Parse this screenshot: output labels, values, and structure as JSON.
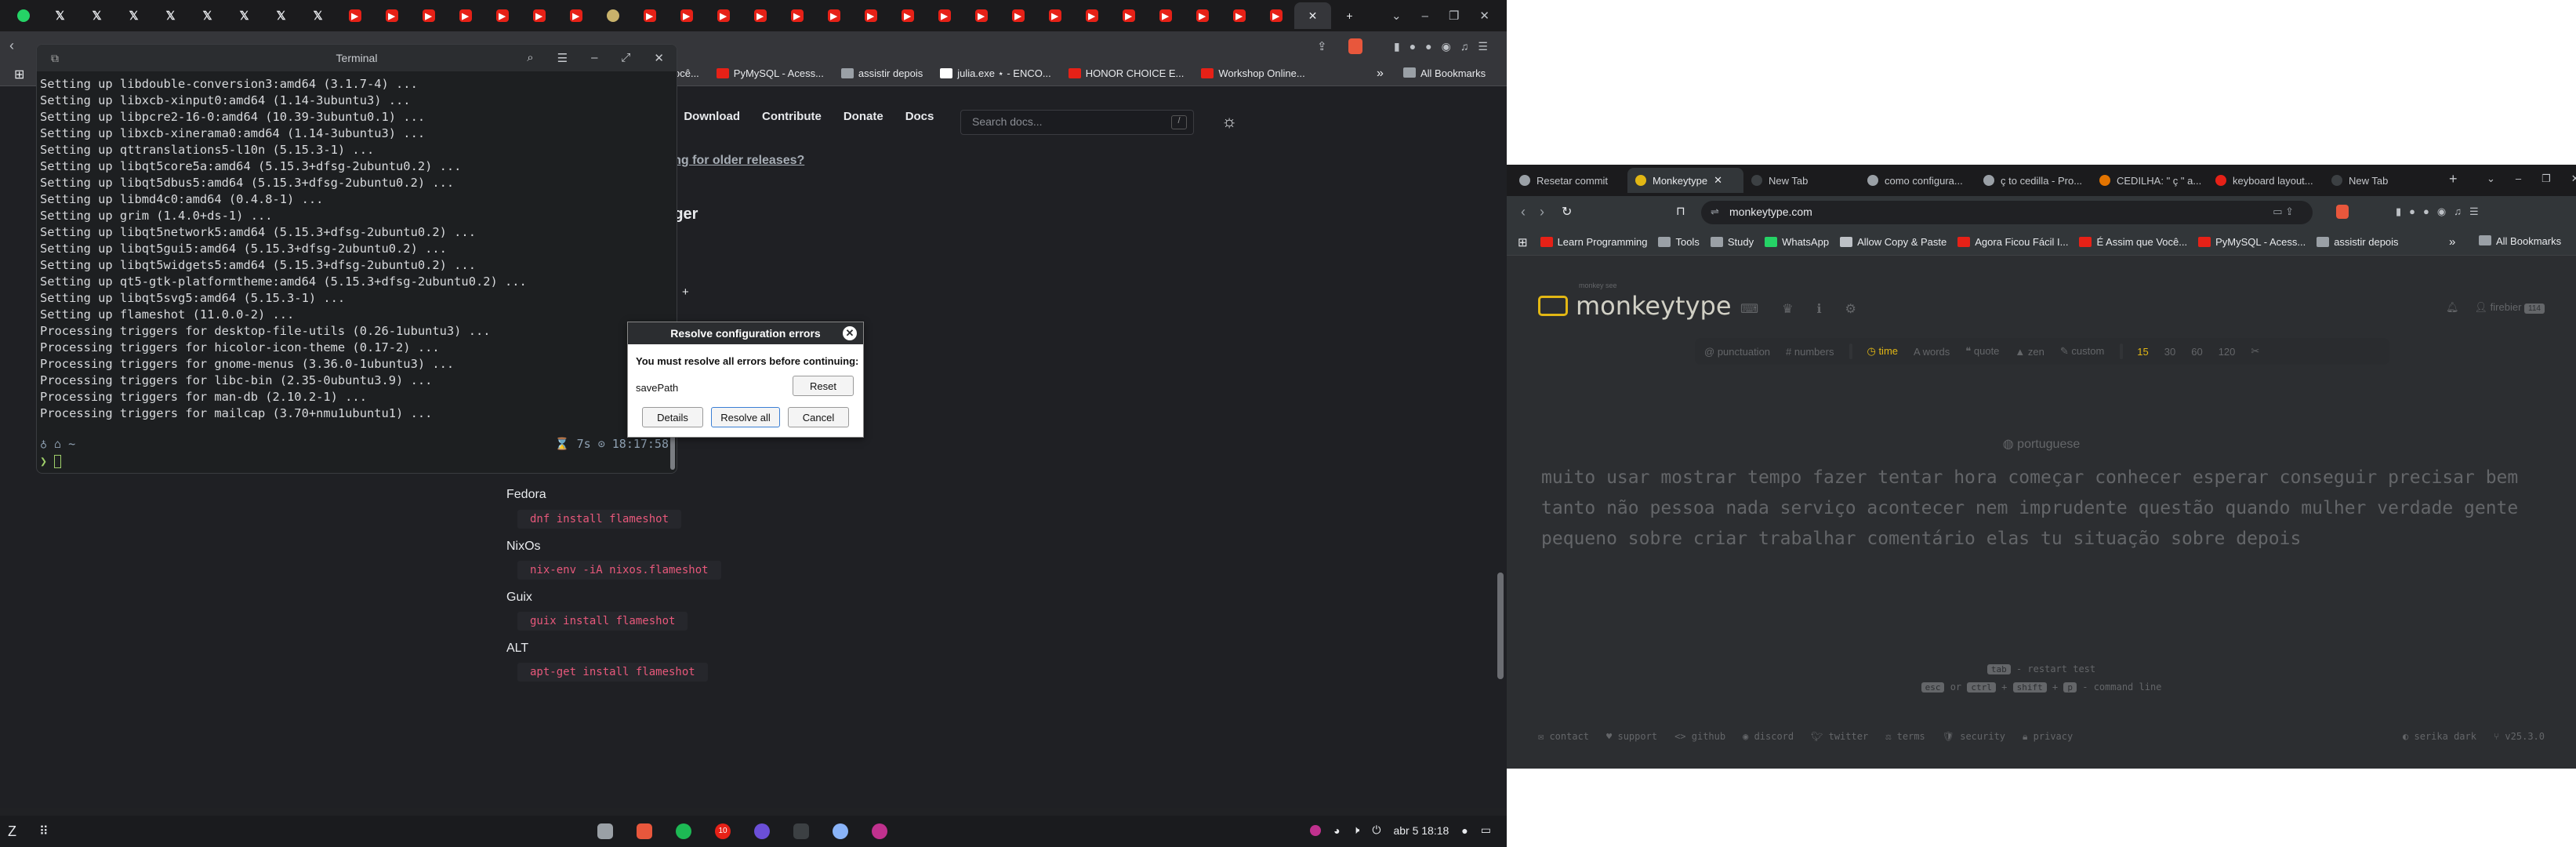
{
  "left_browser": {
    "tabs": [
      "wa",
      "x",
      "x",
      "x",
      "x",
      "x",
      "x",
      "x",
      "x",
      "yt",
      "yt",
      "yt",
      "yt",
      "yt",
      "yt",
      "yt",
      "other",
      "yt",
      "yt",
      "yt",
      "yt",
      "yt",
      "yt",
      "yt",
      "yt",
      "yt",
      "yt",
      "yt",
      "yt",
      "yt",
      "yt",
      "yt",
      "yt",
      "yt",
      "yt"
    ],
    "new_tab": "+",
    "bookmarks": [
      {
        "label": "ocê...",
        "icon": "none"
      },
      {
        "label": "PyMySQL - Acess...",
        "icon": "youtube"
      },
      {
        "label": "assistir depois",
        "icon": "folder"
      },
      {
        "label": "julia.exe ⋆ - ENCO...",
        "icon": "x"
      },
      {
        "label": "HONOR CHOICE E...",
        "icon": "honor"
      },
      {
        "label": "Workshop Online...",
        "icon": "youtube"
      }
    ],
    "all_bookmarks": "All Bookmarks",
    "site": {
      "nav": [
        "s",
        "Download",
        "Contribute",
        "Donate",
        "Docs"
      ],
      "search_placeholder": "Search docs...",
      "search_key": "/",
      "older_link": "oking for older releases?",
      "heading": "nager",
      "plus": "+",
      "distros": [
        {
          "name": "Fedora",
          "cmd": "dnf install flameshot"
        },
        {
          "name": "NixOs",
          "cmd": "nix-env -iA nixos.flameshot"
        },
        {
          "name": "Guix",
          "cmd": "guix install flameshot"
        },
        {
          "name": "ALT",
          "cmd": "apt-get install flameshot"
        }
      ]
    }
  },
  "terminal": {
    "title": "Terminal",
    "lines": [
      "Setting up libdouble-conversion3:amd64 (3.1.7-4) ...",
      "Setting up libxcb-xinput0:amd64 (1.14-3ubuntu3) ...",
      "Setting up libpcre2-16-0:amd64 (10.39-3ubuntu0.1) ...",
      "Setting up libxcb-xinerama0:amd64 (1.14-3ubuntu3) ...",
      "Setting up qttranslations5-l10n (5.15.3-1) ...",
      "Setting up libqt5core5a:amd64 (5.15.3+dfsg-2ubuntu0.2) ...",
      "Setting up libqt5dbus5:amd64 (5.15.3+dfsg-2ubuntu0.2) ...",
      "Setting up libmd4c0:amd64 (0.4.8-1) ...",
      "Setting up grim (1.4.0+ds-1) ...",
      "Setting up libqt5network5:amd64 (5.15.3+dfsg-2ubuntu0.2) ...",
      "Setting up libqt5gui5:amd64 (5.15.3+dfsg-2ubuntu0.2) ...",
      "Setting up libqt5widgets5:amd64 (5.15.3+dfsg-2ubuntu0.2) ...",
      "Setting up qt5-gtk-platformtheme:amd64 (5.15.3+dfsg-2ubuntu0.2) ...",
      "Setting up libqt5svg5:amd64 (5.15.3-1) ...",
      "Setting up flameshot (11.0.0-2) ...",
      "Processing triggers for desktop-file-utils (0.26-1ubuntu3) ...",
      "Processing triggers for hicolor-icon-theme (0.17-2) ...",
      "Processing triggers for gnome-menus (3.36.0-1ubuntu3) ...",
      "Processing triggers for libc-bin (2.35-0ubuntu3.9) ...",
      "Processing triggers for man-db (2.10.2-1) ...",
      "Processing triggers for mailcap (3.70+nmu1ubuntu1) ..."
    ],
    "status_left": "♁ ⌂ ~",
    "status_right": "⌛ 7s ⊙ 18:17:58",
    "prompt": "❯"
  },
  "dialog": {
    "title": "Resolve configuration errors",
    "message": "You must resolve all errors before continuing:",
    "item": "savePath",
    "reset": "Reset",
    "details": "Details",
    "resolve_all": "Resolve all",
    "cancel": "Cancel"
  },
  "taskbar": {
    "clock": "abr 5  18:18",
    "badge": "10"
  },
  "right_browser": {
    "tabs": [
      {
        "label": "Resetar commit",
        "active": false
      },
      {
        "label": "Monkeytype",
        "active": true
      },
      {
        "label": "New Tab",
        "active": false
      },
      {
        "label": "como configura...",
        "active": false
      },
      {
        "label": "ç to cedilla - Pro...",
        "active": false
      },
      {
        "label": "CEDILHA: \" ç \" a...",
        "active": false
      },
      {
        "label": "keyboard layout...",
        "active": false
      },
      {
        "label": "New Tab",
        "active": false
      }
    ],
    "url": "monkeytype.com",
    "bookmarks": [
      "Learn Programming",
      "Tools",
      "Study",
      "WhatsApp",
      "Allow Copy & Paste",
      "Agora Ficou Fácil I...",
      "É Assim que Você...",
      "PyMySQL - Acess...",
      "assistir depois"
    ],
    "all_bookmarks": "All Bookmarks"
  },
  "monkeytype": {
    "subtitle": "monkey see",
    "logo": "monkeytype",
    "user": "firebier",
    "level": "114",
    "config": {
      "left": [
        "punctuation",
        "numbers"
      ],
      "modes": [
        "time",
        "words",
        "quote",
        "zen",
        "custom"
      ],
      "active_mode": "time",
      "times": [
        "15",
        "30",
        "60",
        "120"
      ],
      "active_time": "15"
    },
    "language": "portuguese",
    "words": "muito usar mostrar tempo fazer tentar hora começar conhecer esperar conseguir precisar bem tanto não pessoa nada serviço acontecer nem imprudente questão quando mulher verdade gente pequeno sobre criar trabalhar comentário elas tu situação sobre depois",
    "hint1_key": "tab",
    "hint1_text": "- restart test",
    "hint2_k1": "esc",
    "hint2_or": "or",
    "hint2_k2": "ctrl",
    "hint2_k3": "shift",
    "hint2_k4": "p",
    "hint2_text": "- command line",
    "footer_left": [
      "contact",
      "support",
      "github",
      "discord",
      "twitter",
      "terms",
      "security",
      "privacy"
    ],
    "theme": "serika dark",
    "version": "v25.3.0"
  }
}
